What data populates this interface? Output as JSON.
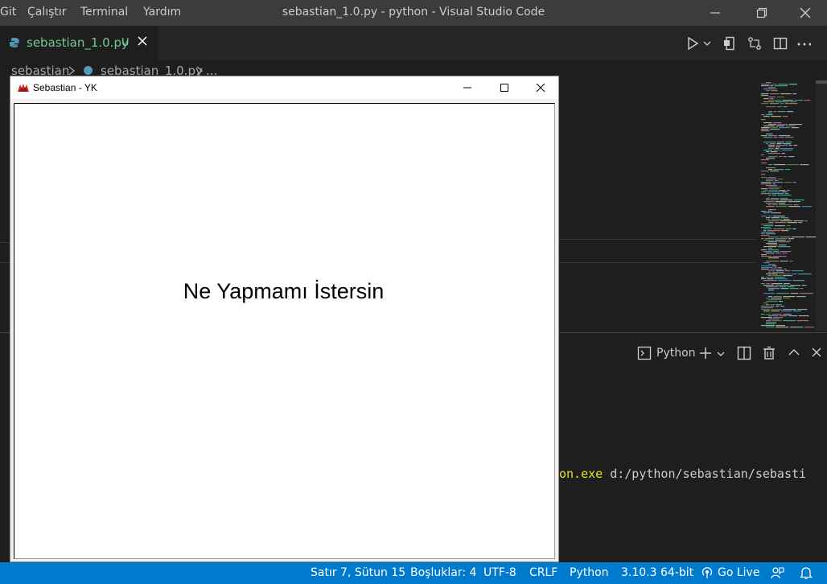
{
  "menu": [
    "Git",
    "Çalıştır",
    "Terminal",
    "Yardım"
  ],
  "window_title": "sebastian_1.0.py - python - Visual Studio Code",
  "tab": {
    "label": "sebastian_1.0.py",
    "status": "U"
  },
  "breadcrumb": {
    "folder": "sebastian",
    "file": "sebastian_1.0.py",
    "more": "..."
  },
  "panel": {
    "terminal_name": "Python"
  },
  "terminal": {
    "yellow": "on.exe",
    "rest": " d:/python/sebastian/sebasti"
  },
  "statusbar": {
    "cursor": "Satır 7, Sütun 15",
    "spaces": "Boşluklar: 4",
    "encoding": "UTF-8",
    "eol": "CRLF",
    "language": "Python",
    "interpreter": "3.10.3 64-bit",
    "golive": "Go Live"
  },
  "tk_window": {
    "title": "Sebastian - YK",
    "label": "Ne Yapmamı İstersin"
  },
  "colors": {
    "accent": "#007acc",
    "modified": "#73c991",
    "terminal_yellow": "#e5e510",
    "python_icon": "#519aba"
  }
}
